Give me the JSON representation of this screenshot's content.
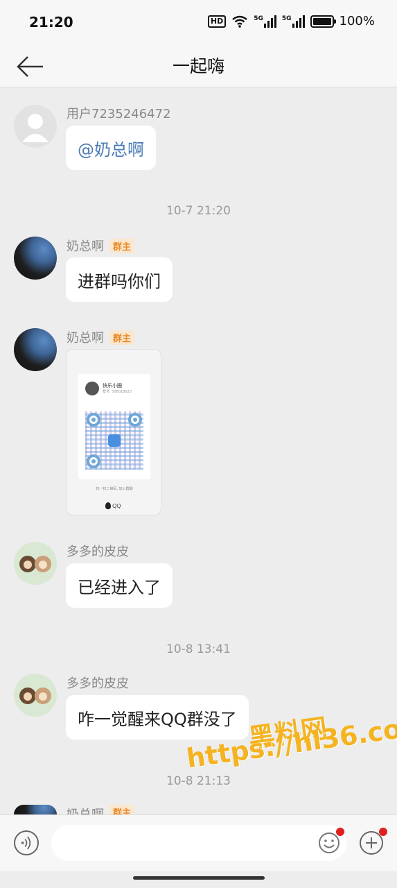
{
  "status_bar": {
    "time": "21:20",
    "hd_label": "HD",
    "sim1_label": "5G",
    "sim2_label": "5G",
    "battery": "100%"
  },
  "header": {
    "title": "一起嗨"
  },
  "messages": [
    {
      "sender": "用户7235246472",
      "text": "@奶总啊"
    },
    {
      "timestamp": "10-7 21:20"
    },
    {
      "sender": "奶总啊",
      "badge": "群主",
      "text": "进群吗你们"
    },
    {
      "sender": "奶总啊",
      "badge": "群主",
      "qr": {
        "name": "快乐小圈",
        "sub": "群号: 706018020",
        "tip": "扫一扫二维码, 加入群聊",
        "brand": "QQ"
      }
    },
    {
      "sender": "多多的皮皮",
      "text": "已经进入了"
    },
    {
      "timestamp": "10-8 13:41"
    },
    {
      "sender": "多多的皮皮",
      "text": "咋一觉醒来QQ群没了"
    },
    {
      "timestamp": "10-8 21:13"
    },
    {
      "sender": "奶总啊",
      "badge": "群主"
    }
  ],
  "watermark": {
    "line1": "黑料网",
    "line2": "https://hl36.co"
  },
  "input_bar": {
    "placeholder": ""
  },
  "colors": {
    "background": "#ededed",
    "badge": "#e88b2a",
    "mention": "#4a7bb5",
    "notify_dot": "#e02020"
  },
  "icons": [
    "back-arrow-icon",
    "wifi-icon",
    "signal-icon",
    "battery-icon",
    "voice-icon",
    "emoji-icon",
    "plus-icon"
  ]
}
